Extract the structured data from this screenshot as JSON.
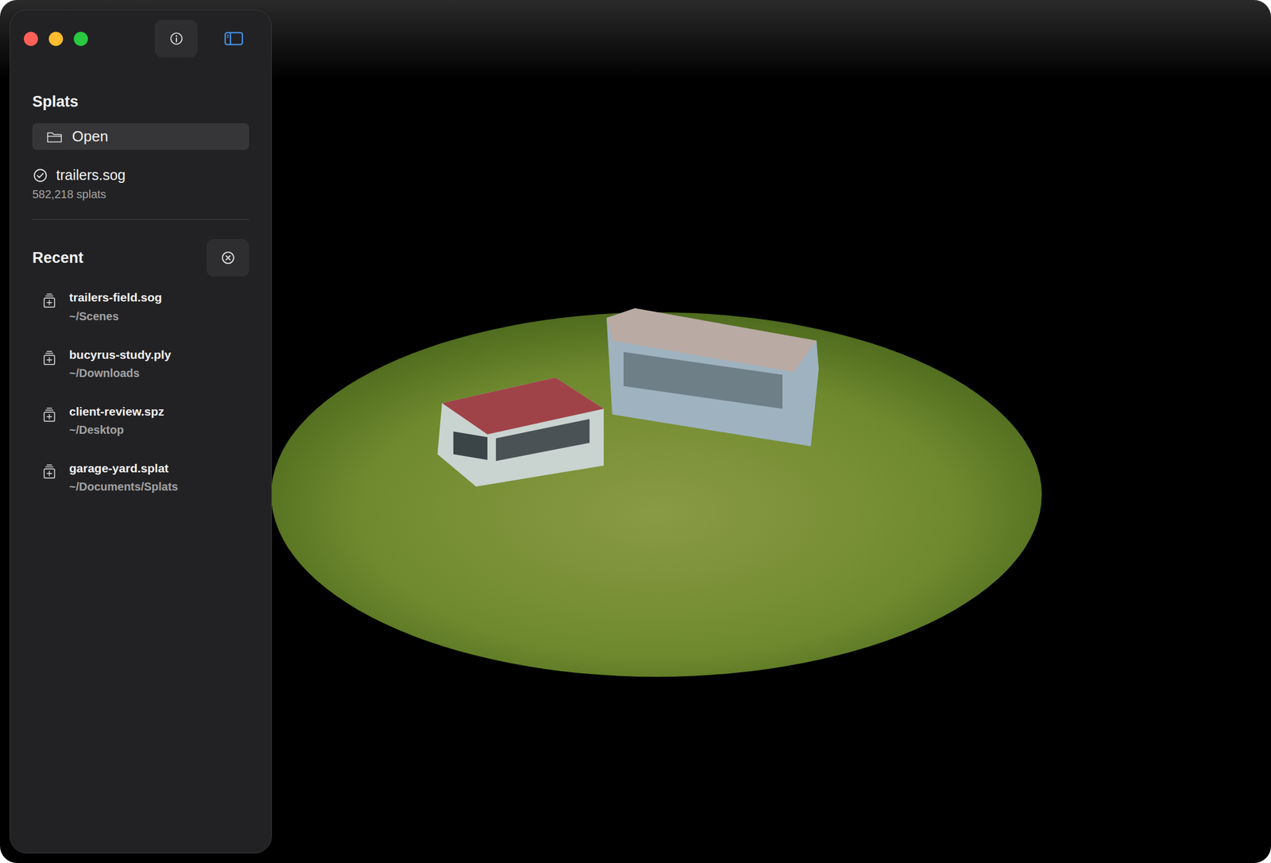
{
  "toolbar": {
    "info_button": {
      "selected": false
    },
    "sidebar_toggle": {
      "selected": true
    }
  },
  "sidebar": {
    "title": "Splats",
    "open_button": "Open",
    "current": {
      "name": "trailers.sog",
      "count": "582,218 splats",
      "loaded": true
    },
    "recent_title": "Recent",
    "recent": [
      {
        "name": "trailers-field.sog",
        "path": "~/Scenes"
      },
      {
        "name": "bucyrus-study.ply",
        "path": "~/Downloads"
      },
      {
        "name": "client-review.spz",
        "path": "~/Desktop"
      },
      {
        "name": "garage-yard.splat",
        "path": "~/Documents/Splats"
      }
    ]
  }
}
